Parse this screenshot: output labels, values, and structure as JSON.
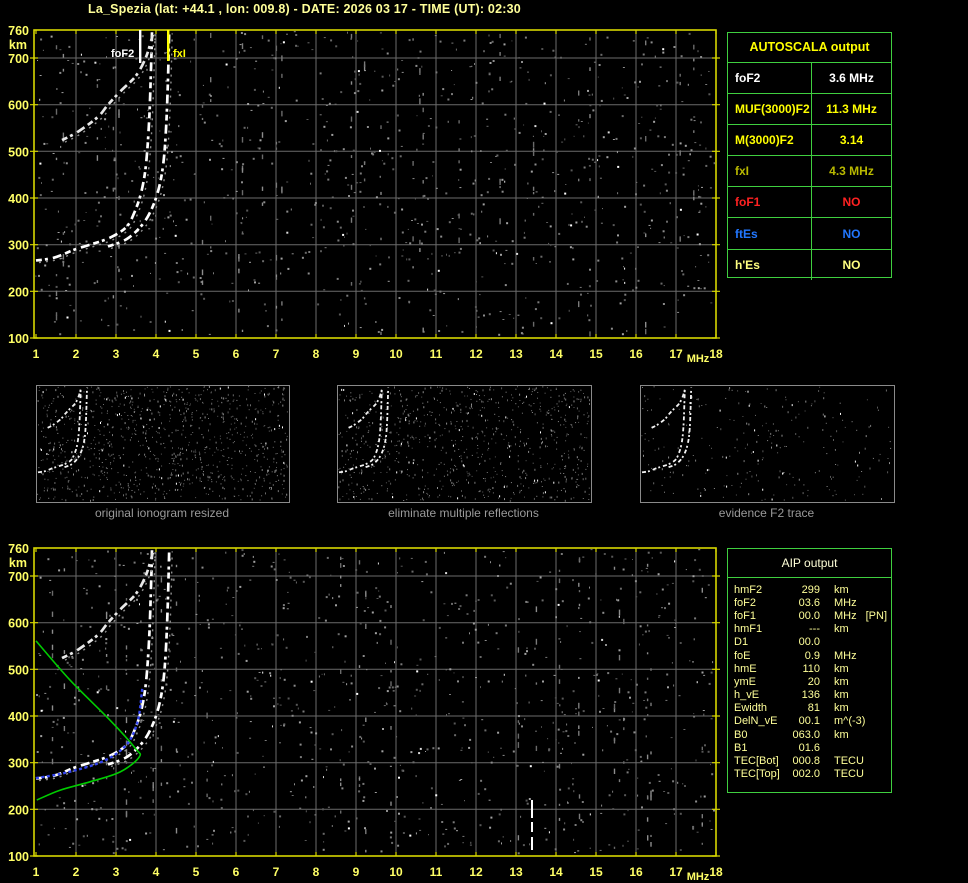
{
  "title": "La_Spezia (lat: +44.1 , lon: 009.8) - DATE: 2026 03 17 - TIME (UT): 02:30",
  "autoscala": {
    "header": "AUTOSCALA output",
    "rows": [
      {
        "label": "foF2",
        "value": "3.6 MHz",
        "color": "#ffffff"
      },
      {
        "label": "MUF(3000)F2",
        "value": "11.3 MHz",
        "color": "#ffff00"
      },
      {
        "label": "M(3000)F2",
        "value": "3.14",
        "color": "#ffff00"
      },
      {
        "label": "fxI",
        "value": "4.3 MHz",
        "color": "#b9b900"
      },
      {
        "label": "foF1",
        "value": "NO",
        "color": "#ff2222"
      },
      {
        "label": "ftEs",
        "value": "NO",
        "color": "#2277ff"
      },
      {
        "label": "h'Es",
        "value": "NO",
        "color": "#ffff80"
      }
    ]
  },
  "aip": {
    "header": "AIP output",
    "rows": [
      {
        "label": "hmF2",
        "value": "299",
        "unit": "km",
        "note": ""
      },
      {
        "label": "foF2",
        "value": "03.6",
        "unit": "MHz",
        "note": ""
      },
      {
        "label": "foF1",
        "value": "00.0",
        "unit": "MHz",
        "note": "[PN]"
      },
      {
        "label": "hmF1",
        "value": "---",
        "unit": "km",
        "note": ""
      },
      {
        "label": "D1",
        "value": "00.0",
        "unit": "",
        "note": ""
      },
      {
        "label": "foE",
        "value": "0.9",
        "unit": "MHz",
        "note": ""
      },
      {
        "label": "hmE",
        "value": "110",
        "unit": "km",
        "note": ""
      },
      {
        "label": "ymE",
        "value": "20",
        "unit": "km",
        "note": ""
      },
      {
        "label": "h_vE",
        "value": "136",
        "unit": "km",
        "note": ""
      },
      {
        "label": "Ewidth",
        "value": "81",
        "unit": "km",
        "note": ""
      },
      {
        "label": "DelN_vE",
        "value": "00.1",
        "unit": "m^(-3)",
        "note": ""
      },
      {
        "label": "B0",
        "value": "063.0",
        "unit": "km",
        "note": ""
      },
      {
        "label": "B1",
        "value": "01.6",
        "unit": "",
        "note": ""
      },
      {
        "label": "TEC[Bot]",
        "value": "000.8",
        "unit": "TECU",
        "note": ""
      },
      {
        "label": "TEC[Top]",
        "value": "002.0",
        "unit": "TECU",
        "note": ""
      }
    ]
  },
  "thumbnails": [
    {
      "caption": "original ionogram resized"
    },
    {
      "caption": "eliminate multiple reflections"
    },
    {
      "caption": "evidence F2 trace"
    }
  ],
  "chart_data": [
    {
      "id": "top-ionogram",
      "type": "scatter",
      "title": "ionogram with autoscaled characteristics",
      "xlabel": "MHz",
      "ylabel": "km",
      "xlim": [
        1,
        18
      ],
      "ylim": [
        100,
        760
      ],
      "grid": true,
      "x_ticks": [
        1,
        2,
        3,
        4,
        5,
        6,
        7,
        8,
        9,
        10,
        11,
        12,
        13,
        14,
        15,
        16,
        17,
        18
      ],
      "x_unit": "MHz",
      "y_ticks": [
        760,
        700,
        600,
        500,
        400,
        300,
        200,
        100
      ],
      "y_unit": "km",
      "markers": [
        {
          "name": "foF2",
          "freq_mhz": 3.6,
          "color": "#ffffff"
        },
        {
          "name": "fxI",
          "freq_mhz": 4.3,
          "color": "#ffff00"
        }
      ],
      "traces": [
        {
          "name": "f2-ordinary-trace",
          "color": "#ffffff",
          "points": [
            [
              1.0,
              266
            ],
            [
              1.45,
              272
            ],
            [
              1.95,
              289
            ],
            [
              2.35,
              300
            ],
            [
              2.85,
              315
            ],
            [
              3.25,
              337
            ],
            [
              3.45,
              367
            ],
            [
              3.63,
              412
            ],
            [
              3.75,
              472
            ],
            [
              3.83,
              568
            ],
            [
              3.88,
              690
            ],
            [
              3.9,
              757
            ]
          ]
        },
        {
          "name": "f2-extraordinary-trace",
          "color": "#ffffff",
          "points": [
            [
              2.8,
              296
            ],
            [
              3.25,
              311
            ],
            [
              3.6,
              337
            ],
            [
              3.85,
              369
            ],
            [
              4.05,
              414
            ],
            [
              4.18,
              472
            ],
            [
              4.25,
              547
            ],
            [
              4.3,
              655
            ],
            [
              4.33,
              757
            ]
          ]
        },
        {
          "name": "second-hop-trace",
          "color": "#e8e8e8",
          "points": [
            [
              1.65,
              524
            ],
            [
              2.05,
              542
            ],
            [
              2.55,
              574
            ],
            [
              2.8,
              600
            ],
            [
              3.15,
              632
            ],
            [
              3.5,
              662
            ],
            [
              3.75,
              702
            ],
            [
              3.92,
              750
            ]
          ]
        }
      ]
    },
    {
      "id": "bottom-ionogram",
      "type": "scatter",
      "title": "ionogram with restored trace and electron density profile",
      "xlabel": "MHz",
      "ylabel": "km",
      "xlim": [
        1,
        18
      ],
      "ylim": [
        100,
        760
      ],
      "grid": true,
      "x_ticks": [
        1,
        2,
        3,
        4,
        5,
        6,
        7,
        8,
        9,
        10,
        11,
        12,
        13,
        14,
        15,
        16,
        17,
        18
      ],
      "x_unit": "MHz",
      "y_ticks": [
        760,
        700,
        600,
        500,
        400,
        300,
        200,
        100
      ],
      "y_unit": "km",
      "markers": [],
      "traces": [
        {
          "name": "f2-ordinary-trace",
          "color": "#ffffff",
          "points": [
            [
              1.0,
              266
            ],
            [
              1.45,
              272
            ],
            [
              1.95,
              289
            ],
            [
              2.35,
              300
            ],
            [
              2.85,
              315
            ],
            [
              3.25,
              337
            ],
            [
              3.45,
              367
            ],
            [
              3.63,
              412
            ],
            [
              3.75,
              472
            ],
            [
              3.83,
              568
            ],
            [
              3.88,
              690
            ],
            [
              3.9,
              757
            ]
          ]
        },
        {
          "name": "f2-extraordinary-trace",
          "color": "#ffffff",
          "points": [
            [
              2.8,
              296
            ],
            [
              3.25,
              311
            ],
            [
              3.6,
              337
            ],
            [
              3.85,
              369
            ],
            [
              4.05,
              414
            ],
            [
              4.18,
              472
            ],
            [
              4.25,
              547
            ],
            [
              4.3,
              655
            ],
            [
              4.33,
              757
            ]
          ]
        },
        {
          "name": "second-hop-trace",
          "color": "#e8e8e8",
          "points": [
            [
              1.65,
              524
            ],
            [
              2.05,
              542
            ],
            [
              2.55,
              574
            ],
            [
              2.8,
              600
            ],
            [
              3.15,
              632
            ],
            [
              3.5,
              662
            ],
            [
              3.75,
              702
            ],
            [
              3.92,
              750
            ]
          ]
        },
        {
          "name": "electron-density-profile",
          "color": "#00cc00",
          "points": [
            [
              1.0,
              561
            ],
            [
              1.85,
              477
            ],
            [
              2.85,
              391
            ],
            [
              3.48,
              331
            ],
            [
              3.58,
              312
            ],
            [
              3.1,
              280
            ],
            [
              2.35,
              259
            ],
            [
              1.6,
              241
            ],
            [
              1.02,
              220
            ]
          ]
        },
        {
          "name": "restored-trace",
          "color": "#3344ee",
          "points": [
            [
              1.0,
              267
            ],
            [
              1.5,
              274
            ],
            [
              2.0,
              284
            ],
            [
              2.5,
              297
            ],
            [
              2.9,
              313
            ],
            [
              3.2,
              333
            ],
            [
              3.4,
              356
            ],
            [
              3.55,
              391
            ],
            [
              3.62,
              430
            ],
            [
              3.66,
              462
            ]
          ]
        }
      ]
    }
  ]
}
